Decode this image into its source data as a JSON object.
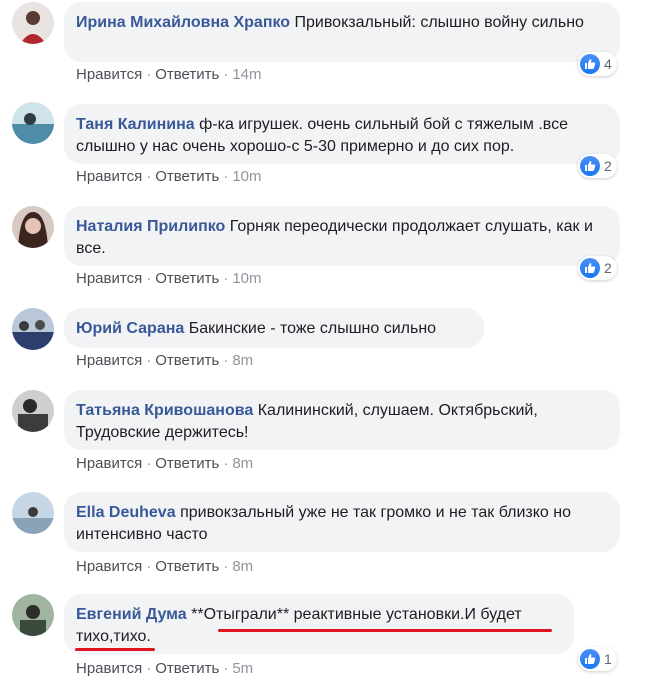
{
  "colors": {
    "author": "#385898",
    "bubble": "#f2f3f5",
    "like": "#1877f2",
    "highlight": "#e0141e"
  },
  "comments": [
    {
      "author": "Ирина Михайловна Храпко",
      "text": "Привокзальный: слышно войну сильно",
      "like": "Нравится",
      "reply": "Ответить",
      "time": "14m",
      "reactions": "4"
    },
    {
      "author": "Таня Калинина",
      "text": "ф-ка игрушек. очень сильный бой с тяжелым .все слышно у нас очень хорошо-с 5-30 примерно и до сих пор.",
      "like": "Нравится",
      "reply": "Ответить",
      "time": "10m",
      "reactions": "2"
    },
    {
      "author": "Наталия Прилипко",
      "text": "Горняк переодически продолжает слушать, как и все.",
      "like": "Нравится",
      "reply": "Ответить",
      "time": "10m",
      "reactions": "2"
    },
    {
      "author": "Юрий Сарана",
      "text": "Бакинские - тоже слышно сильно",
      "like": "Нравится",
      "reply": "Ответить",
      "time": "8m"
    },
    {
      "author": "Татьяна Кривошанова",
      "text": "Калининский, слушаем. Октябрьский, Трудовские держитесь!",
      "like": "Нравится",
      "reply": "Ответить",
      "time": "8m"
    },
    {
      "author": "Ella Deuheva",
      "text": "привокзальный уже не так громко и не так близко но интенсивно часто",
      "like": "Нравится",
      "reply": "Ответить",
      "time": "8m"
    },
    {
      "author": "Евгений Дума",
      "text": "**Отыграли** реактивные установки.И будет тихо,тихо.",
      "like": "Нравится",
      "reply": "Ответить",
      "time": "5m",
      "reactions": "1"
    }
  ]
}
